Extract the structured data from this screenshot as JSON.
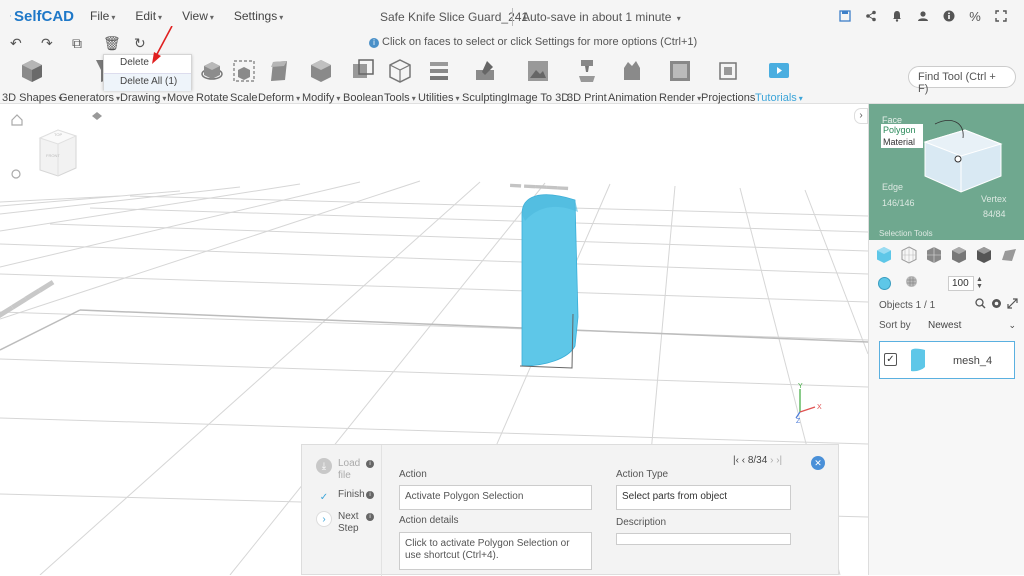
{
  "app": {
    "name": "SelfCAD",
    "document_title": "Safe Knife Slice Guard_241",
    "autosave": "Auto-save in about 1 minute"
  },
  "menu": [
    {
      "label": "File"
    },
    {
      "label": "Edit"
    },
    {
      "label": "View"
    },
    {
      "label": "Settings"
    }
  ],
  "hint": "Click on faces to select or click Settings for more options (Ctrl+1)",
  "dropdown": {
    "delete": "Delete",
    "delete_all": "Delete All (1)"
  },
  "tools": [
    {
      "label": "3D Shapes",
      "caret": true
    },
    {
      "label": "Generators",
      "caret": true
    },
    {
      "label": "Drawing",
      "caret": true
    },
    {
      "label": "Move"
    },
    {
      "label": "Rotate"
    },
    {
      "label": "Scale"
    },
    {
      "label": "Deform",
      "caret": true
    },
    {
      "label": "Modify",
      "caret": true
    },
    {
      "label": "Boolean"
    },
    {
      "label": "Tools",
      "caret": true
    },
    {
      "label": "Utilities",
      "caret": true
    },
    {
      "label": "Sculpting"
    },
    {
      "label": "Image To 3D"
    },
    {
      "label": "3D Print"
    },
    {
      "label": "Animation"
    },
    {
      "label": "Render",
      "caret": true
    },
    {
      "label": "Projections"
    },
    {
      "label": "Tutorials",
      "caret": true
    }
  ],
  "find_tool": "Find Tool (Ctrl + F)",
  "selection_panel": {
    "face": "Face",
    "polygon": "Polygon",
    "material": "Material",
    "edge": "Edge",
    "edge_count": "146/146",
    "vertex": "Vertex",
    "vertex_count": "84/84",
    "selection_tools": "Selection Tools"
  },
  "opacity": "100",
  "objects": {
    "label": "Objects 1 / 1",
    "sort_label": "Sort by",
    "sort_value": "Newest",
    "items": [
      {
        "name": "mesh_4"
      }
    ]
  },
  "tutorial": {
    "steps": [
      {
        "label": "Load file"
      },
      {
        "label": "Finish"
      },
      {
        "label": "Next Step"
      }
    ],
    "action_label": "Action",
    "action_value": "Activate Polygon Selection",
    "details_label": "Action details",
    "details_value": "Click to activate Polygon Selection or use shortcut (Ctrl+4).",
    "type_label": "Action Type",
    "type_value": "Select parts from object",
    "description_label": "Description",
    "description_value": "",
    "pager": "8/34"
  },
  "colors": {
    "accent": "#3da5d9",
    "mesh": "#5ec7e8",
    "panel_green": "#6fa88f"
  }
}
